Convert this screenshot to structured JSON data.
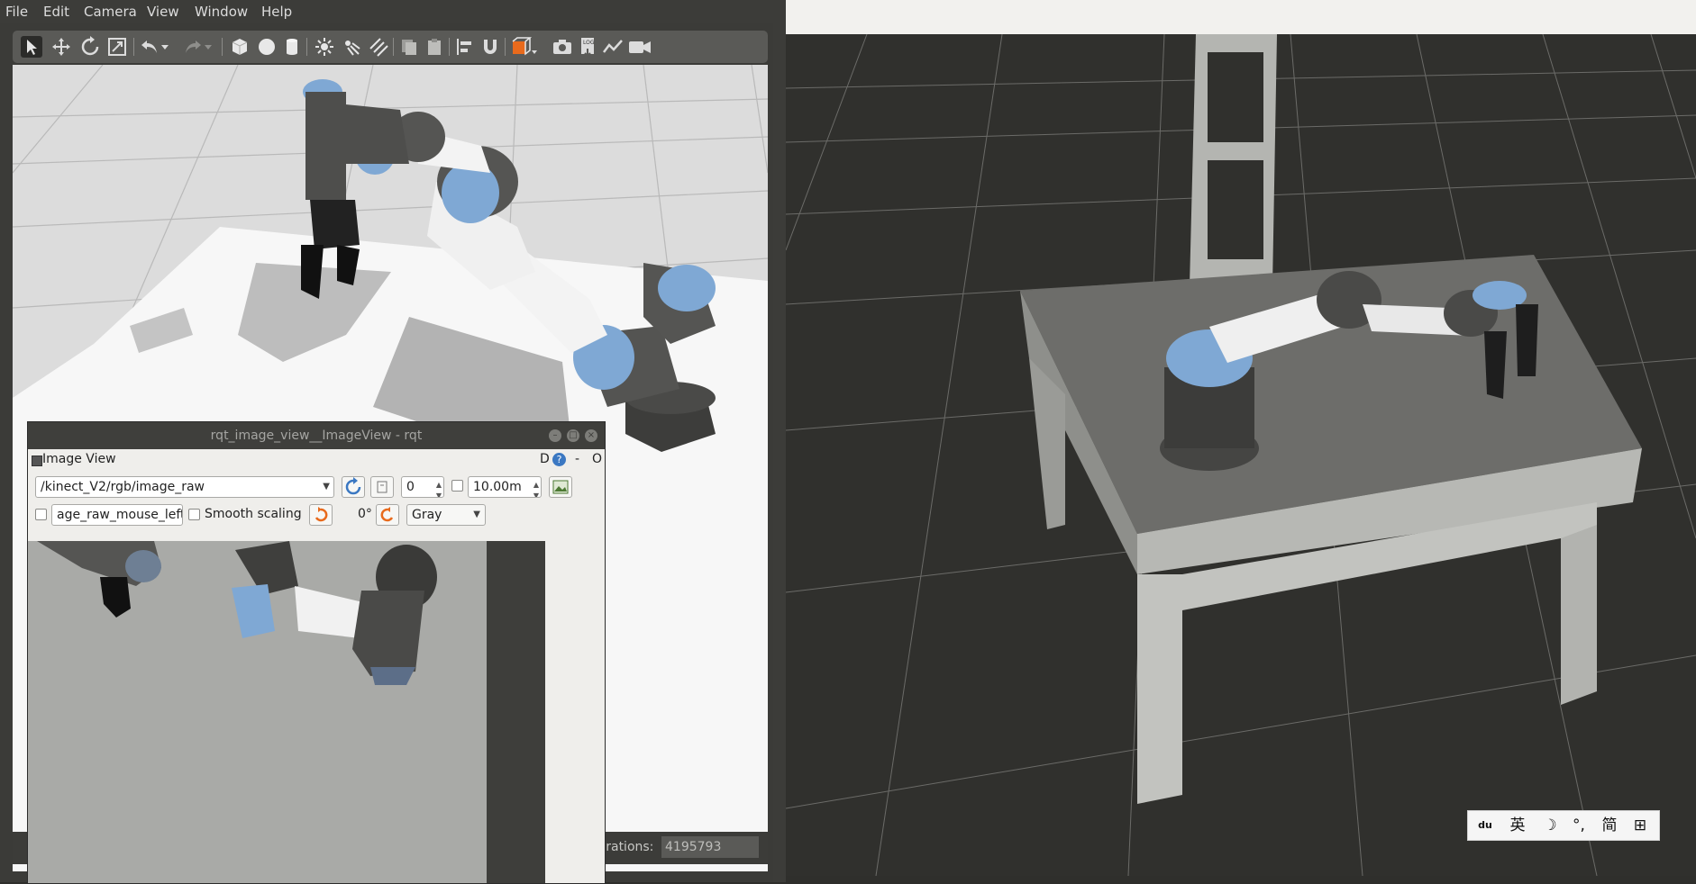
{
  "gazebo": {
    "menu": [
      "File",
      "Edit",
      "Camera",
      "View",
      "Window",
      "Help"
    ],
    "toolbar_icons": [
      "select-arrow-icon",
      "translate-icon",
      "rotate-icon",
      "scale-icon",
      "undo-icon",
      "undo-history-icon",
      "redo-icon",
      "redo-history-icon",
      "box-icon",
      "sphere-icon",
      "cylinder-icon",
      "point-light-icon",
      "spot-light-icon",
      "directional-light-icon",
      "copy-icon",
      "paste-icon",
      "align-icon",
      "snap-icon",
      "view-angle-icon",
      "screenshot-icon",
      "log-icon",
      "plot-icon",
      "video-record-icon"
    ],
    "status": {
      "iterations_label": "Iterations:",
      "iterations_value": "4195793"
    }
  },
  "rqt": {
    "title": "rqt_image_view__ImageView - rqt",
    "panel_title": "Image View",
    "panel_controls": [
      "D",
      "?",
      "-",
      "O"
    ],
    "topic": "/kinect_V2/rgb/image_raw",
    "spin_value": "0",
    "max_range": "10.00m",
    "mouse_topic": "age_raw_mouse_left",
    "smooth_scaling_label": "Smooth scaling",
    "rotation": "0°",
    "color_scheme": "Gray"
  },
  "ime": {
    "items": [
      "du",
      "英",
      "☽",
      "°,",
      "简",
      "⊞"
    ]
  },
  "colors": {
    "robot_blue": "#7fa8d4",
    "robot_dark": "#4a4a48",
    "ground": "#dcdcdc",
    "rviz_grid_bg": "#30302d"
  }
}
